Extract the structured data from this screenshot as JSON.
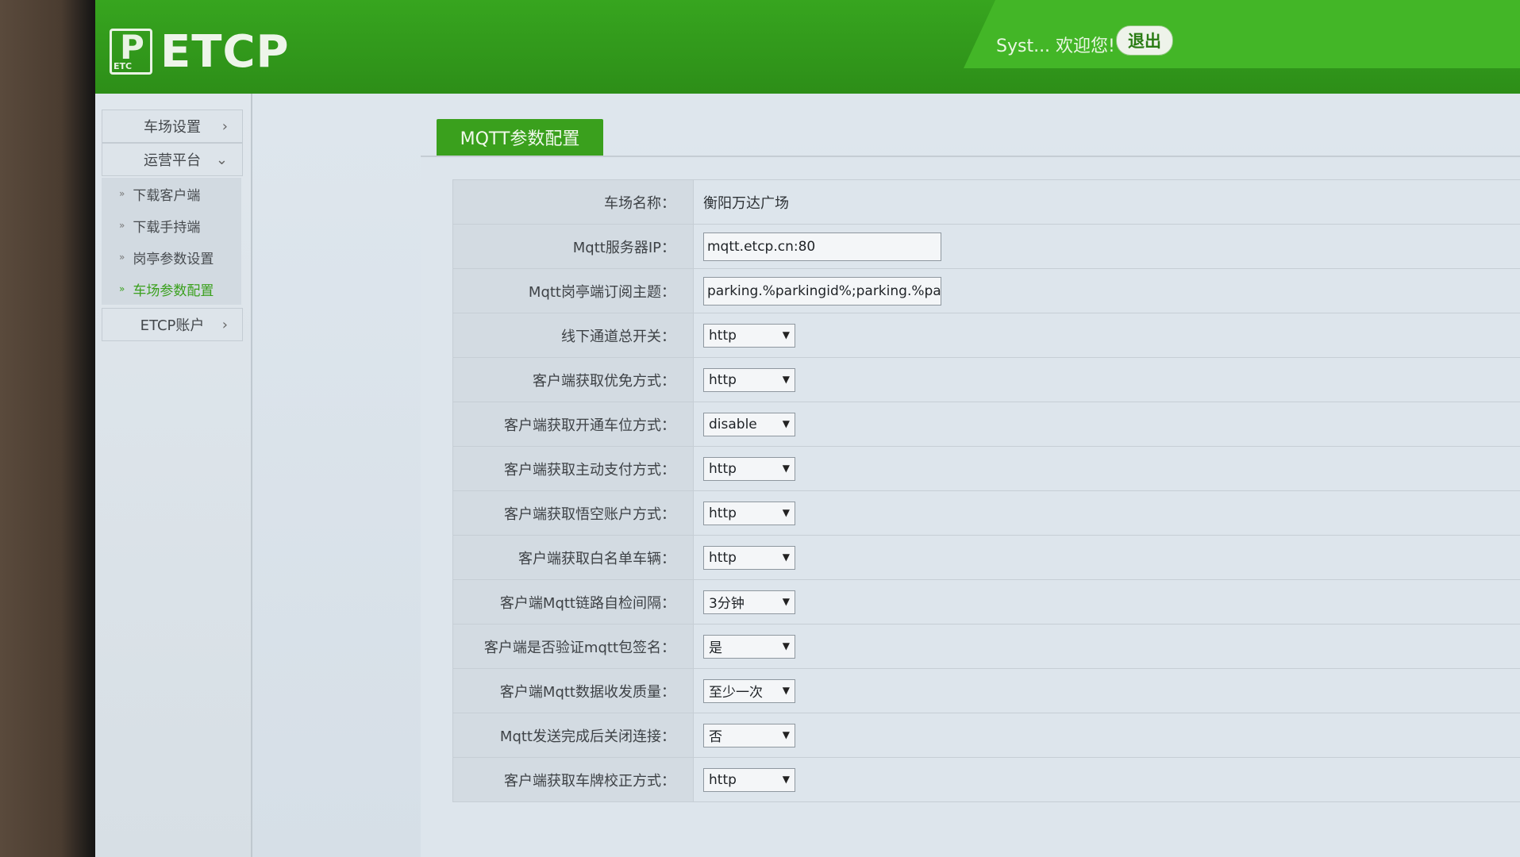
{
  "header": {
    "logo_text": "ETCP",
    "logo_badge": "ETC",
    "welcome": "Syst... 欢迎您!",
    "logout_label": "退出"
  },
  "sidebar": {
    "groups": [
      {
        "label": "车场设置",
        "arrow": "›"
      },
      {
        "label": "运营平台",
        "arrow": "⌄"
      },
      {
        "label": "ETCP账户",
        "arrow": "›"
      }
    ],
    "subitems": [
      {
        "label": "下载客户端",
        "marker": "»"
      },
      {
        "label": "下载手持端",
        "marker": "»"
      },
      {
        "label": "岗亭参数设置",
        "marker": "»"
      },
      {
        "label": "车场参数配置",
        "marker": "»",
        "active": true
      }
    ]
  },
  "panel": {
    "tab_title": "MQTT参数配置",
    "rows": [
      {
        "label": "车场名称：",
        "type": "text",
        "value": "衡阳万达广场"
      },
      {
        "label": "Mqtt服务器IP：",
        "type": "input",
        "value": "mqtt.etcp.cn:80"
      },
      {
        "label": "Mqtt岗亭端订阅主题：",
        "type": "input",
        "value": "parking.%parkingid%;parking.%pai"
      },
      {
        "label": "线下通道总开关：",
        "type": "select",
        "value": "http"
      },
      {
        "label": "客户端获取优免方式：",
        "type": "select",
        "value": "http"
      },
      {
        "label": "客户端获取开通车位方式：",
        "type": "select",
        "value": "disable"
      },
      {
        "label": "客户端获取主动支付方式：",
        "type": "select",
        "value": "http"
      },
      {
        "label": "客户端获取悟空账户方式：",
        "type": "select",
        "value": "http"
      },
      {
        "label": "客户端获取白名单车辆：",
        "type": "select",
        "value": "http"
      },
      {
        "label": "客户端Mqtt链路自检间隔：",
        "type": "select",
        "value": "3分钟"
      },
      {
        "label": "客户端是否验证mqtt包签名：",
        "type": "select",
        "value": "是"
      },
      {
        "label": "客户端Mqtt数据收发质量：",
        "type": "select",
        "value": "至少一次"
      },
      {
        "label": "Mqtt发送完成后关闭连接：",
        "type": "select",
        "value": "否"
      },
      {
        "label": "客户端获取车牌校正方式：",
        "type": "select",
        "value": "http"
      }
    ]
  },
  "colors": {
    "brand_green": "#37a51f",
    "active_green": "#3aa01d"
  }
}
